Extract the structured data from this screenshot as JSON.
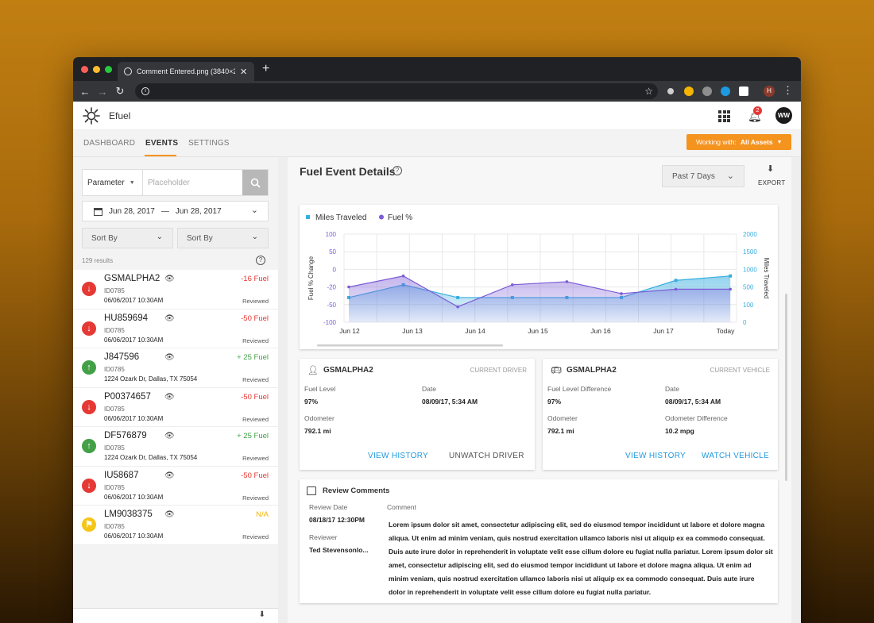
{
  "browser": {
    "tab_title": "Comment Entered.png (3840×2160)",
    "tab_close": "✕",
    "new_tab": "+",
    "profile_initial": "H"
  },
  "app": {
    "name": "Efuel",
    "notification_count": "2",
    "user_initials": "WW"
  },
  "nav": {
    "tabs": [
      "DASHBOARD",
      "EVENTS",
      "SETTINGS"
    ],
    "active_tab": "EVENTS",
    "working_with_label": "Working with:",
    "working_with_value": "All Assets"
  },
  "filters": {
    "parameter_label": "Parameter",
    "search_placeholder": "Placeholder",
    "date_from": "Jun 28, 2017",
    "date_sep": "—",
    "date_to": "Jun 28, 2017",
    "sort1": "Sort By",
    "sort2": "Sort By",
    "results_count": "129 results"
  },
  "events": [
    {
      "name": "GSMALPHA2",
      "id": "ID0785",
      "sub": "06/06/2017 10:30AM",
      "value": "-16 Fuel",
      "status": "Reviewed",
      "kind": "down"
    },
    {
      "name": "HU859694",
      "id": "ID0785",
      "sub": "06/06/2017 10:30AM",
      "value": "-50 Fuel",
      "status": "Reviewed",
      "kind": "down"
    },
    {
      "name": "J847596",
      "id": "ID0785",
      "sub": "1224 Ozark Dr, Dallas, TX 75054",
      "value": "+ 25 Fuel",
      "status": "Reviewed",
      "kind": "up"
    },
    {
      "name": "P00374657",
      "id": "ID0785",
      "sub": "06/06/2017 10:30AM",
      "value": "-50 Fuel",
      "status": "Reviewed",
      "kind": "down"
    },
    {
      "name": "DF576879",
      "id": "ID0785",
      "sub": "1224 Ozark Dr, Dallas, TX 75054",
      "value": "+ 25 Fuel",
      "status": "Reviewed",
      "kind": "up"
    },
    {
      "name": "IU58687",
      "id": "ID0785",
      "sub": "06/06/2017 10:30AM",
      "value": "-50 Fuel",
      "status": "Reviewed",
      "kind": "down"
    },
    {
      "name": "LM9038375",
      "id": "ID0785",
      "sub": "06/06/2017 10:30AM",
      "value": "N/A",
      "status": "Reviewed",
      "kind": "flag"
    }
  ],
  "details": {
    "title": "Fuel Event Details",
    "period": "Past 7 Days",
    "export_label": "EXPORT"
  },
  "chart_data": {
    "type": "line",
    "categories": [
      "Jun 12",
      "Jun 13",
      "Jun 14",
      "Jun 15",
      "Jun 16",
      "Jun 17",
      "Today"
    ],
    "series": [
      {
        "name": "Miles Traveled",
        "axis": "right",
        "color": "#3aaee0",
        "values": [
          560,
          850,
          560,
          560,
          560,
          560,
          950,
          1050
        ]
      },
      {
        "name": "Fuel %",
        "axis": "left",
        "color": "#7b5bd6",
        "values": [
          -20,
          5,
          -65,
          -15,
          -8,
          -35,
          -25,
          -25
        ]
      }
    ],
    "x_points": 8,
    "ylabel_left": "Fuel % Change",
    "ylabel_right": "Miles Traveled",
    "y_left_ticks": [
      "100",
      "50",
      "0",
      "-20",
      "-50",
      "-100"
    ],
    "y_right_ticks": [
      "2000",
      "1500",
      "1000",
      "500",
      "100",
      "0"
    ],
    "grid": true,
    "legend_position": "top-left"
  },
  "driver": {
    "name": "GSMALPHA2",
    "role": "CURRENT DRIVER",
    "fuel_level_label": "Fuel Level",
    "fuel_level": "97%",
    "date_label": "Date",
    "date": "08/09/17, 5:34 AM",
    "odometer_label": "Odometer",
    "odometer": "792.1 mi",
    "action1": "VIEW HISTORY",
    "action2": "UNWATCH DRIVER"
  },
  "vehicle": {
    "name": "GSMALPHA2",
    "role": "CURRENT VEHICLE",
    "fuel_diff_label": "Fuel Level Difference",
    "fuel_diff": "97%",
    "date_label": "Date",
    "date": "08/09/17, 5:34 AM",
    "odometer_label": "Odometer",
    "odometer": "792.1 mi",
    "odo_diff_label": "Odometer Difference",
    "odo_diff": "10.2 mpg",
    "action1": "VIEW HISTORY",
    "action2": "WATCH VEHICLE"
  },
  "review": {
    "title": "Review Comments",
    "date_label": "Review Date",
    "date": "08/18/17 12:30PM",
    "reviewer_label": "Reviewer",
    "reviewer": "Ted Stevensonlo...",
    "comment_label": "Comment",
    "comment": "Lorem ipsum dolor sit amet, consectetur adipiscing elit, sed do eiusmod tempor incididunt ut labore et dolore magna aliqua. Ut enim ad minim veniam, quis nostrud exercitation ullamco laboris nisi ut aliquip ex ea commodo consequat. Duis aute irure dolor in reprehenderit in voluptate velit esse cillum dolore eu fugiat nulla pariatur. Lorem ipsum dolor sit amet, consectetur adipiscing elit, sed do eiusmod tempor incididunt ut labore et dolore magna aliqua. Ut enim ad minim veniam, quis nostrud exercitation ullamco laboris nisi ut aliquip ex ea commodo consequat. Duis aute irure dolor in reprehenderit in voluptate velit esse cillum dolore eu fugiat nulla pariatur."
  },
  "colors": {
    "accent": "#f5931f",
    "link": "#1e9ae0",
    "down": "#e53935",
    "up": "#43a047",
    "flag": "#f5c518",
    "negative_text": "#e53935",
    "positive_text": "#43a047",
    "na_text": "#f5b400"
  }
}
